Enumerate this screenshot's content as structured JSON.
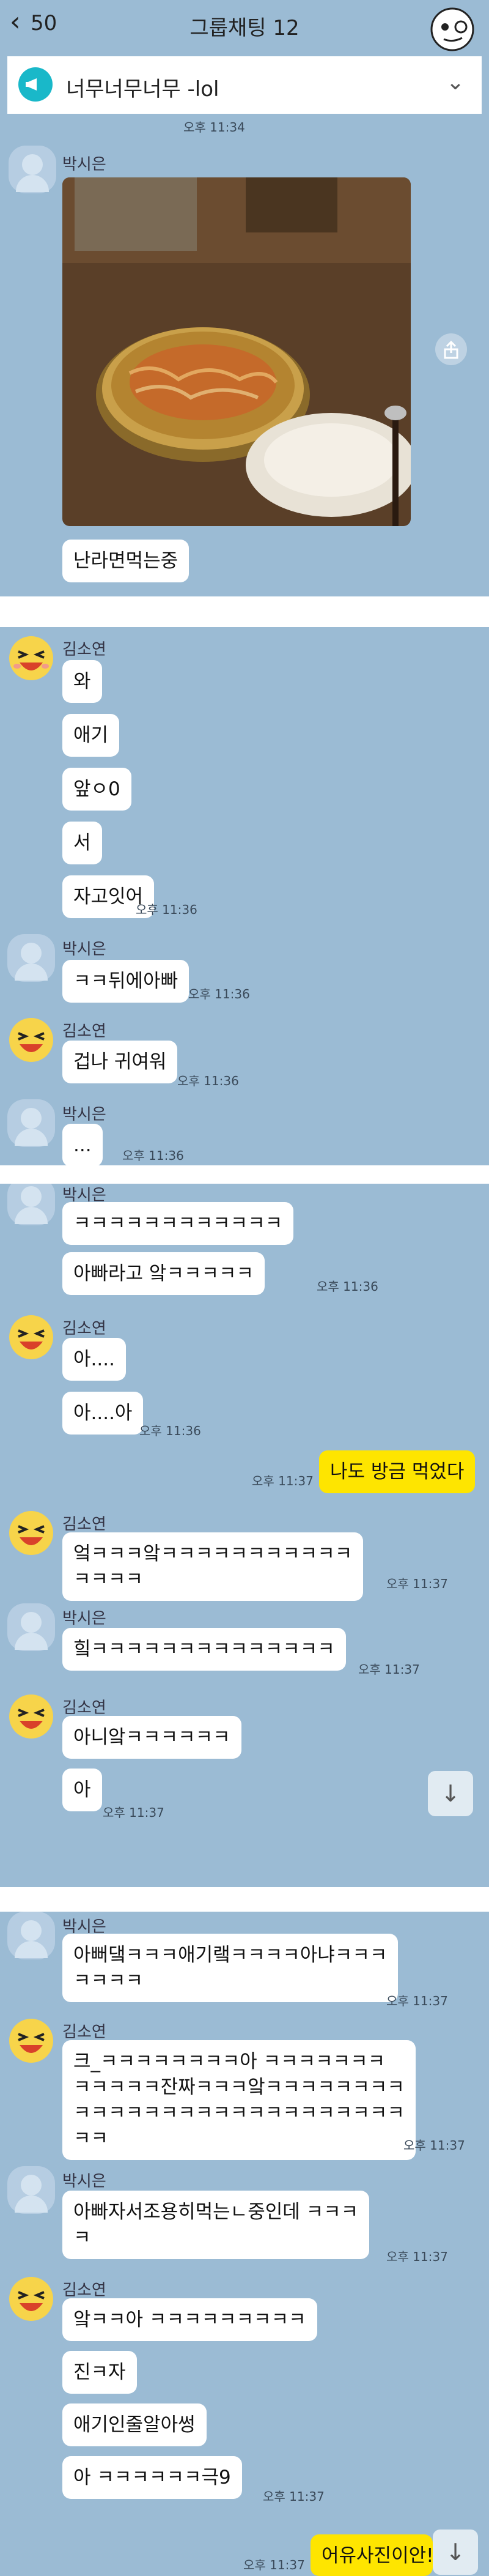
{
  "header": {
    "back_count": "50",
    "title": "그룹채팅 12"
  },
  "notice": {
    "text": "너무너무너무 -lol"
  },
  "colors": {
    "chat_bg": "#9bbbd4",
    "my_bubble": "#fee500",
    "their_bubble": "#ffffff",
    "unread": "#ffd400"
  },
  "panel1": {
    "top_time": "오후 11:34",
    "sender": "박시은",
    "caption": "난라면먹는중"
  },
  "panel2": {
    "n1": "김소연",
    "m1": "와",
    "m2": "애기",
    "m3": "앞ㅇ0",
    "m4": "서",
    "m5": "자고잇어",
    "t1": "오후 11:36",
    "n2": "박시은",
    "m6": "ㅋㅋ뒤에아빠",
    "t2": "오후 11:36",
    "n3": "김소연",
    "m7": "겁나 귀여워",
    "t3": "오후 11:36",
    "n4": "박시은",
    "m8": "...",
    "t4": "오후 11:36"
  },
  "panel3": {
    "n0": "박시은",
    "m1": "ㅋㅋㅋㅋㅋㅋㅋㅋㅋㅋㅋㅋ",
    "m2": "아빠라고     앜ㅋㅋㅋㅋㅋ",
    "t1": "오후 11:36",
    "n1": "김소연",
    "m3": "아....",
    "m4": "아....아",
    "t2": "오후 11:36",
    "t3": "오후 11:37",
    "mine1": "나도 방금 먹었다",
    "n2": "김소연",
    "m5": "엌ㅋㅋㅋ앜ㅋㅋㅋㅋㅋㅋㅋㅋㅋㅋㅋ\nㅋㅋㅋㅋ",
    "t4": "오후 11:37",
    "n3": "박시은",
    "m6": "힠ㅋㅋㅋㅋㅋㅋㅋㅋㅋㅋㅋㅋㅋㅋ",
    "t5": "오후 11:37",
    "n4": "김소연",
    "m7": "아니앜ㅋㅋㅋㅋㅋㅋ",
    "m8": "아",
    "t6": "오후 11:37"
  },
  "panel4": {
    "n1": "박시은",
    "m1": "아뻐댘ㅋㅋㅋ애기랰ㅋㅋㅋㅋ아냐ㅋㅋㅋ\nㅋㅋㅋㅋ",
    "t1": "오후 11:37",
    "n2": "김소연",
    "m2": "크_ㅋㅋㅋㅋㅋㅋㅋㅋ아 ㅋㅋㅋㅋㅋㅋㅋ\nㅋㅋㅋㅋㅋ잔짜ㅋㅋㅋ앜ㅋㅋㅋㅋㅋㅋㅋㅋ\nㅋㅋㅋㅋㅋㅋㅋㅋㅋㅋㅋㅋㅋㅋㅋㅋㅋㅋㅋ\nㅋㅋ",
    "t2": "오후 11:37",
    "n3": "박시은",
    "m3": "아빠자서조용히먹는ㄴ중인데      ㅋㅋㅋ\nㅋ",
    "t3": "오후 11:37",
    "n4": "김소연",
    "m4": "앜ㅋㅋ아       ㅋㅋㅋㅋㅋㅋㅋㅋㅋ",
    "m5": "진ㅋ자",
    "m6": "애기인줄알아썽",
    "m7": "아 ㅋㅋㅋㅋㅋㅋ극9",
    "t4": "오후 11:37",
    "t5": "오후 11:37",
    "mine1": "어유사진이안!"
  }
}
